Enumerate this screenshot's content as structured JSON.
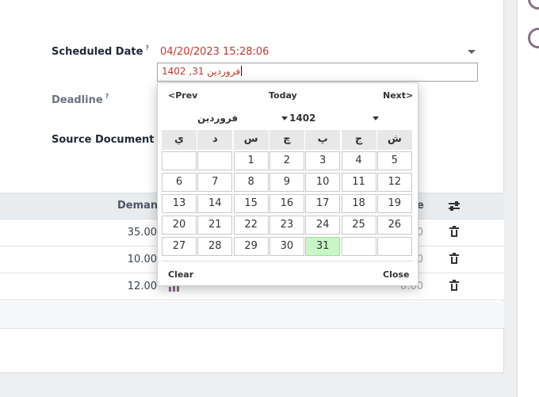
{
  "form": {
    "scheduled_label": "Scheduled Date",
    "deadline_label": "Deadline",
    "source_label": "Source Document",
    "help_mark": "?",
    "scheduled_value": "04/20/2023 15:28:06",
    "input_value": "فروردین 31, 1402"
  },
  "table": {
    "header_demand": "Demand",
    "header_partial": "e",
    "rows": [
      {
        "demand": "35.00",
        "quantity": "0.00"
      },
      {
        "demand": "10.00",
        "quantity": "0.00"
      },
      {
        "demand": "12.00",
        "quantity": "0.00"
      }
    ]
  },
  "datepicker": {
    "prev": "<Prev",
    "today": "Today",
    "next": "Next>",
    "month": "فروردین",
    "year": "1402",
    "weekdays": [
      "ي",
      "د",
      "س",
      "چ",
      "پ",
      "ج",
      "ش"
    ],
    "weeks": [
      [
        "",
        "",
        "1",
        "2",
        "3",
        "4",
        "5"
      ],
      [
        "6",
        "7",
        "8",
        "9",
        "10",
        "11",
        "12"
      ],
      [
        "13",
        "14",
        "15",
        "16",
        "17",
        "18",
        "19"
      ],
      [
        "20",
        "21",
        "22",
        "23",
        "24",
        "25",
        "26"
      ],
      [
        "27",
        "28",
        "29",
        "30",
        "31",
        "",
        ""
      ]
    ],
    "selected_day": "31",
    "clear": "Clear",
    "close": "Close"
  },
  "colors": {
    "accent_red": "#c0392b",
    "today_bg": "#c8f7c5",
    "brand": "#8b6f88"
  }
}
